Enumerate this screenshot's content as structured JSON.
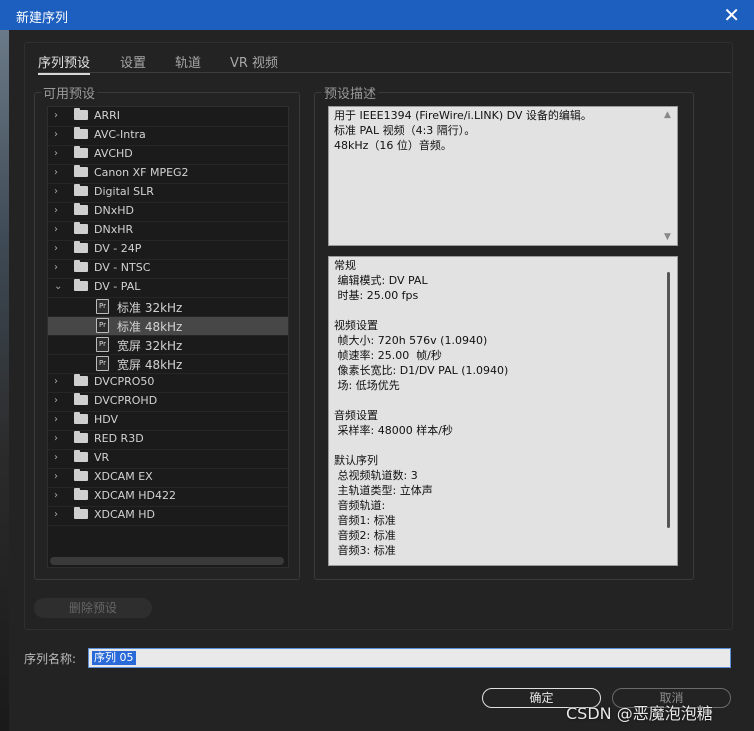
{
  "window": {
    "title": "新建序列"
  },
  "tabs": [
    "序列预设",
    "设置",
    "轨道",
    "VR 视频"
  ],
  "presets": {
    "group_label": "可用预设",
    "items": [
      {
        "label": "ARRI",
        "type": "folder",
        "expanded": false
      },
      {
        "label": "AVC-Intra",
        "type": "folder",
        "expanded": false
      },
      {
        "label": "AVCHD",
        "type": "folder",
        "expanded": false
      },
      {
        "label": "Canon XF MPEG2",
        "type": "folder",
        "expanded": false
      },
      {
        "label": "Digital SLR",
        "type": "folder",
        "expanded": false
      },
      {
        "label": "DNxHD",
        "type": "folder",
        "expanded": false
      },
      {
        "label": "DNxHR",
        "type": "folder",
        "expanded": false
      },
      {
        "label": "DV - 24P",
        "type": "folder",
        "expanded": false
      },
      {
        "label": "DV - NTSC",
        "type": "folder",
        "expanded": false
      },
      {
        "label": "DV - PAL",
        "type": "folder",
        "expanded": true
      },
      {
        "label": "标准 32kHz",
        "type": "preset",
        "selected": false
      },
      {
        "label": "标准 48kHz",
        "type": "preset",
        "selected": true
      },
      {
        "label": "宽屏 32kHz",
        "type": "preset",
        "selected": false
      },
      {
        "label": "宽屏 48kHz",
        "type": "preset",
        "selected": false
      },
      {
        "label": "DVCPRO50",
        "type": "folder",
        "expanded": false
      },
      {
        "label": "DVCPROHD",
        "type": "folder",
        "expanded": false
      },
      {
        "label": "HDV",
        "type": "folder",
        "expanded": false
      },
      {
        "label": "RED R3D",
        "type": "folder",
        "expanded": false
      },
      {
        "label": "VR",
        "type": "folder",
        "expanded": false
      },
      {
        "label": "XDCAM EX",
        "type": "folder",
        "expanded": false
      },
      {
        "label": "XDCAM HD422",
        "type": "folder",
        "expanded": false
      },
      {
        "label": "XDCAM HD",
        "type": "folder",
        "expanded": false
      }
    ]
  },
  "description": {
    "group_label": "预设描述",
    "text": "用于 IEEE1394 (FireWire/i.LINK) DV 设备的编辑。\n标准 PAL 视频（4:3 隔行）。\n48kHz（16 位）音频。"
  },
  "info": {
    "text": "常规\n 编辑模式: DV PAL\n 时基: 25.00 fps\n\n视频设置\n 帧大小: 720h 576v (1.0940)\n 帧速率: 25.00  帧/秒\n 像素长宽比: D1/DV PAL (1.0940)\n 场: 低场优先\n\n音频设置\n 采样率: 48000 样本/秒\n\n默认序列\n 总视频轨道数: 3\n 主轨道类型: 立体声\n 音频轨道:\n 音频1: 标准\n 音频2: 标准\n 音频3: 标准"
  },
  "buttons": {
    "delete": "删除预设",
    "ok": "确定",
    "cancel": "取消"
  },
  "sequence_name": {
    "label": "序列名称:",
    "value": "序列 05"
  },
  "watermark": "CSDN @恶魔泡泡糖",
  "colors": {
    "titlebar": "#1d5fbf",
    "background": "#232323",
    "selection": "#474747",
    "text_highlight": "#2a6ad8"
  }
}
